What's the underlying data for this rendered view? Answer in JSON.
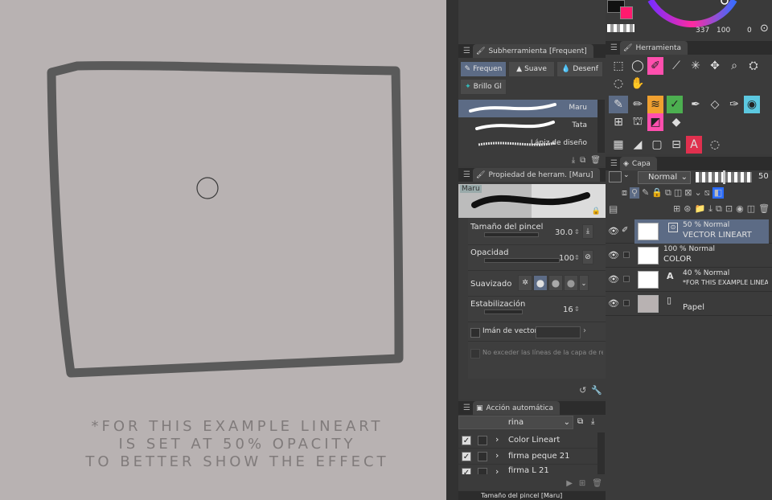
{
  "canvas": {
    "note_lines": [
      "*FOR THIS EXAMPLE LINEART",
      "IS SET AT 50% OPACITY",
      "TO BETTER SHOW THE EFFECT"
    ]
  },
  "color_panel": {
    "readout": "337",
    "readout2": "100",
    "readout3": "0"
  },
  "subtool_panel": {
    "title": "Subherramienta [Frequent]",
    "groups": [
      "Frequen",
      "Suave",
      "Desenf"
    ],
    "group2": "Brillo Gl",
    "brushes": [
      "Maru",
      "Tata",
      "Lápiz de diseño"
    ]
  },
  "tool_property": {
    "title": "Propiedad de herram. [Maru]",
    "preview_name": "Maru",
    "brush_size_label": "Tamaño del pincel",
    "brush_size_value": "30.0",
    "opacity_label": "Opacidad",
    "opacity_value": "100",
    "smoothing_label": "Suavizado",
    "stabilization_label": "Estabilización",
    "stabilization_value": "16",
    "vector_magnet_label": "Imán de vectores",
    "no_exceed_label": "No exceder las líneas de la capa de refe"
  },
  "auto_action": {
    "title": "Acción automática",
    "set_name": "rina",
    "items": [
      "Color Lineart",
      "firma peque 21",
      "firma L 21"
    ]
  },
  "bottom_tab": {
    "title": "Tamaño del pincel [Maru]"
  },
  "tool_panel": {
    "title": "Herramienta"
  },
  "layer_panel": {
    "title": "Capa",
    "blend_mode": "Normal",
    "opacity_value": "50",
    "layers": [
      {
        "mode": "50 % Normal",
        "name": "VECTOR LINEART",
        "selected": true
      },
      {
        "mode": "100 % Normal",
        "name": "COLOR",
        "selected": false
      },
      {
        "mode": "40 % Normal",
        "name": "*FOR THIS EXAMPLE LINEAR",
        "selected": false
      },
      {
        "mode": "",
        "name": "Papel",
        "selected": false
      }
    ]
  },
  "colors": {
    "accent": "#ff1a6e",
    "selected_row": "#5c6b85",
    "canvas_bg": "#b8b2b2",
    "stroke": "#555555"
  }
}
